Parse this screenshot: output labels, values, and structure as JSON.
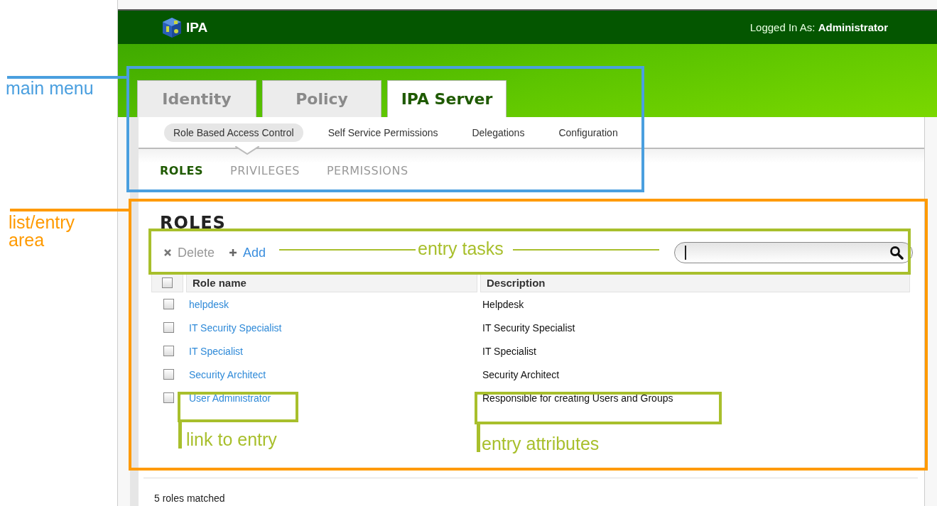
{
  "header": {
    "app_name": "IPA",
    "login_label": "Logged In As:",
    "user": "Administrator"
  },
  "tabs": [
    {
      "label": "Identity",
      "selected": false
    },
    {
      "label": "Policy",
      "selected": false
    },
    {
      "label": "IPA Server",
      "selected": true
    }
  ],
  "subnav": [
    {
      "label": "Role Based Access Control",
      "selected": true
    },
    {
      "label": "Self Service Permissions",
      "selected": false
    },
    {
      "label": "Delegations",
      "selected": false
    },
    {
      "label": "Configuration",
      "selected": false
    }
  ],
  "subtabs": [
    {
      "label": "ROLES",
      "selected": true
    },
    {
      "label": "PRIVILEGES",
      "selected": false
    },
    {
      "label": "PERMISSIONS",
      "selected": false
    }
  ],
  "list": {
    "title": "ROLES",
    "actions": [
      {
        "kind": "delete",
        "label": "Delete",
        "disabled": true
      },
      {
        "kind": "add",
        "label": "Add",
        "disabled": false
      }
    ],
    "select_all_checked": false,
    "columns": [
      "Role name",
      "Description"
    ],
    "rows": [
      {
        "name": "helpdesk",
        "description": "Helpdesk",
        "checked": false
      },
      {
        "name": "IT Security Specialist",
        "description": "IT Security Specialist",
        "checked": false
      },
      {
        "name": "IT Specialist",
        "description": "IT Specialist",
        "checked": false
      },
      {
        "name": "Security Architect",
        "description": "Security Architect",
        "checked": false
      },
      {
        "name": "User Administrator",
        "description": "Responsible for creating Users and Groups",
        "checked": false
      }
    ],
    "status": "5 roles matched"
  },
  "annotations": [
    {
      "text": "main menu",
      "color": "#4a9fdf"
    },
    {
      "text": "list/entry area",
      "color": "#ff9a00"
    },
    {
      "text": "entry tasks",
      "color": "#a8bf2c"
    },
    {
      "text": "link to entry",
      "color": "#a8bf2c"
    },
    {
      "text": "entry attributes",
      "color": "#a8bf2c"
    }
  ]
}
